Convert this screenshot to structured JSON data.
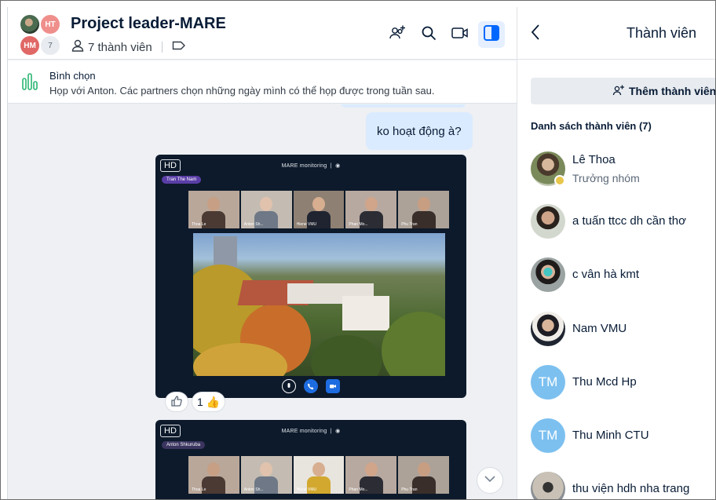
{
  "chat": {
    "title": "Project leader-MARE",
    "avatars": [
      "HT",
      "HM",
      "7"
    ],
    "member_count_label": "7 thành viên"
  },
  "poll": {
    "title": "Bình chọn",
    "description": "Họp với Anton. Các partners chọn những ngày mình có thể họp được trong tuần sau."
  },
  "messages": {
    "text_bubble": "ko hoạt động à?",
    "screenshot1": {
      "hd": "HD",
      "title": "MARE monitoring",
      "speaker": "Tran The Nam",
      "thumbs": [
        "Thoa Le",
        "Anton Sh...",
        "Hiene VMU",
        "Phan Mo...",
        "Phu Tran"
      ]
    },
    "screenshot2": {
      "hd": "HD",
      "title": "MARE monitoring",
      "speaker": "Anton Shkuruba",
      "thumbs": [
        "Thoa Le",
        "Anton Sh...",
        "Hiene VMU",
        "Phan Mo...",
        "Phu Tran"
      ]
    },
    "reaction_count": "1",
    "reaction_emoji": "👍"
  },
  "panel": {
    "title": "Thành viên",
    "add_button": "Thêm thành viên",
    "list_title": "Danh sách thành viên (7)",
    "members": [
      {
        "name": "Lê Thoa",
        "role": "Trưởng nhóm"
      },
      {
        "name": "a tuấn ttcc dh cần thơ"
      },
      {
        "name": "c vân hà kmt"
      },
      {
        "name": "Nam VMU"
      },
      {
        "name": "Thu Mcd Hp",
        "initials": "TM"
      },
      {
        "name": "Thu Minh CTU",
        "initials": "TM"
      },
      {
        "name": "thu viện hdh nha trang"
      }
    ]
  },
  "colors": {
    "accent": "#0068ff",
    "bubble": "#dbebff",
    "chat_bg": "#eef0f3",
    "avatar_tm": "#7cc0f0"
  }
}
